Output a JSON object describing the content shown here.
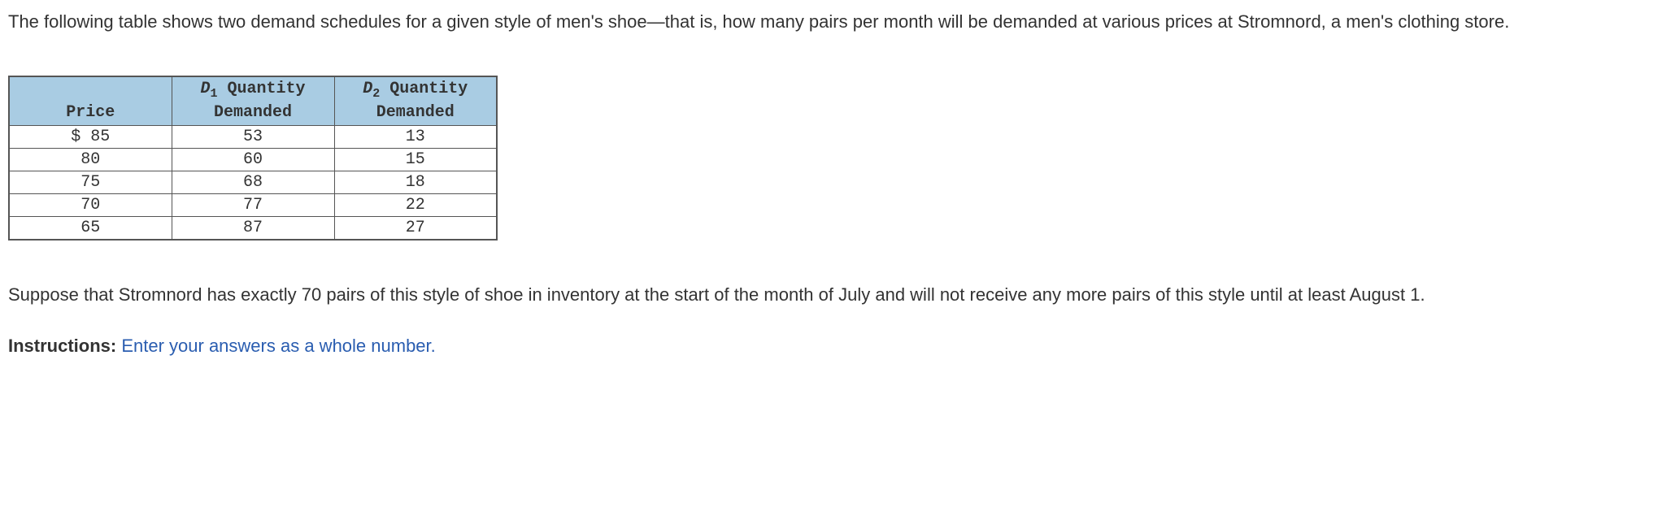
{
  "intro": "The following table shows two demand schedules for a given style of men's shoe—that is, how many pairs per month will be demanded at various prices at Stromnord, a men's clothing store.",
  "table": {
    "headers": {
      "price": "Price",
      "d1_prefix": "D",
      "d1_sub": "1",
      "d1_suffix": " Quantity",
      "d1_line2": "Demanded",
      "d2_prefix": "D",
      "d2_sub": "2",
      "d2_suffix": " Quantity",
      "d2_line2": "Demanded"
    },
    "rows": [
      {
        "price": "$ 85",
        "d1": "53",
        "d2": "13"
      },
      {
        "price": "80",
        "d1": "60",
        "d2": "15"
      },
      {
        "price": "75",
        "d1": "68",
        "d2": "18"
      },
      {
        "price": "70",
        "d1": "77",
        "d2": "22"
      },
      {
        "price": "65",
        "d1": "87",
        "d2": "27"
      }
    ]
  },
  "scenario": "Suppose that Stromnord has exactly 70 pairs of this style of shoe in inventory at the start of the month of July and will not receive any more pairs of this style until at least August 1.",
  "instructions_label": "Instructions:",
  "instructions_text": " Enter your answers as a whole number."
}
